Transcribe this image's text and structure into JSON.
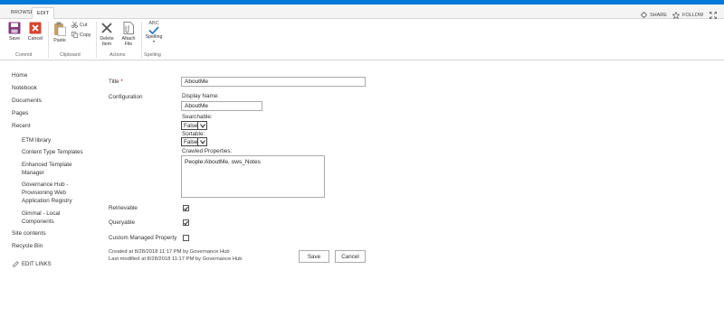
{
  "tabs": {
    "browse": "BROWSE",
    "edit": "EDIT"
  },
  "top_actions": {
    "share": "SHARE",
    "follow": "FOLLOW"
  },
  "ribbon": {
    "save": "Save",
    "cancel": "Cancel",
    "paste": "Paste",
    "cut": "Cut",
    "copy": "Copy",
    "delete_item": "Delete Item",
    "attach_file": "Attach File",
    "spelling": "Spelling",
    "spelling_icon_text": "ABC",
    "groups": {
      "commit": "Commit",
      "clipboard": "Clipboard",
      "actions": "Actions",
      "spelling": "Spelling"
    }
  },
  "leftnav": {
    "home": "Home",
    "notebook": "Notebook",
    "documents": "Documents",
    "pages": "Pages",
    "recent": "Recent",
    "recent_items": [
      "ETM library",
      "Content Type Templates",
      "Enhanced Template Manager",
      "Governance Hub - Provisioning Web Application Registry",
      "Gimmal - Local Components"
    ],
    "site_contents": "Site contents",
    "recycle_bin": "Recycle Bin",
    "edit_links": "EDIT LINKS"
  },
  "form": {
    "title_label": "Title",
    "required_marker": "*",
    "title_value": "AboutMe",
    "configuration_label": "Configuration",
    "display_name_label": "Display Name:",
    "display_name_value": "AboutMe",
    "searchable_label": "Searchable:",
    "searchable_value": "False",
    "sortable_label": "Sortable:",
    "sortable_value": "False",
    "crawled_properties_label": "Crawled Properties:",
    "crawled_properties_value": "People:AboutMe, ows_Notes",
    "retrievable_label": "Retrievable",
    "retrievable_checked": true,
    "queryable_label": "Queryable",
    "queryable_checked": true,
    "custom_managed_label": "Custom Managed Property",
    "custom_managed_checked": false,
    "created_text": "Created at 8/28/2018 11:17 PM  by Governance Hub",
    "modified_text": "Last modified at 8/28/2018 11:17 PM  by Governance Hub",
    "save_button": "Save",
    "cancel_button": "Cancel"
  },
  "colors": {
    "accent": "#0078d7",
    "save_icon": "#80397b",
    "cancel_icon": "#d9452b",
    "check_icon": "#2b7bd2"
  }
}
